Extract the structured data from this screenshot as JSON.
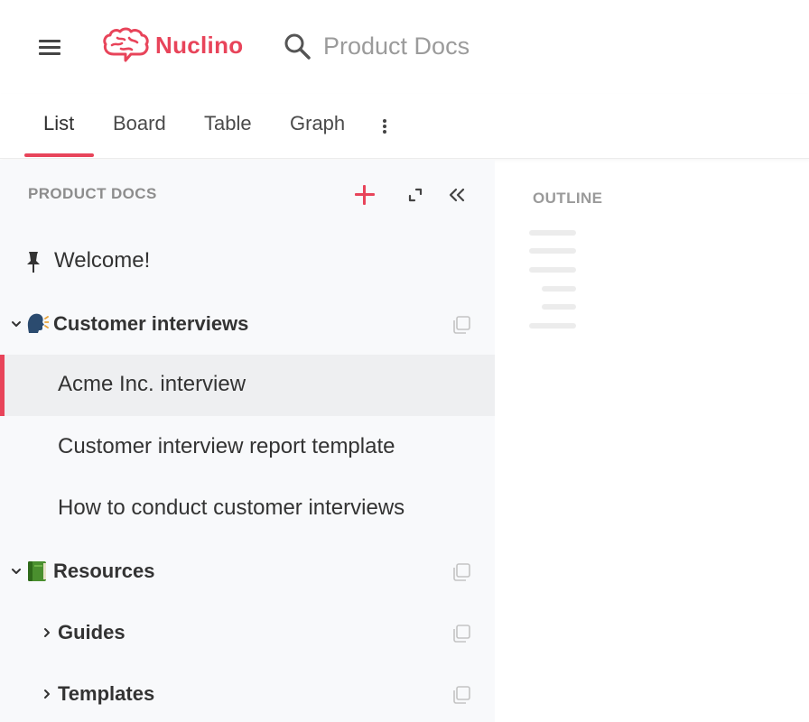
{
  "header": {
    "logo_text": "Nuclino",
    "search_text": "Product Docs"
  },
  "tabs": [
    {
      "label": "List",
      "active": true
    },
    {
      "label": "Board",
      "active": false
    },
    {
      "label": "Table",
      "active": false
    },
    {
      "label": "Graph",
      "active": false
    }
  ],
  "sidebar": {
    "title": "PRODUCT DOCS",
    "items": [
      {
        "label": "Welcome!",
        "icon": "pin-icon",
        "bold": false
      },
      {
        "label": "Customer interviews",
        "icon": "speaking-head-emoji",
        "bold": true,
        "expanded": true
      },
      {
        "label": "Acme Inc. interview",
        "bold": false,
        "selected": true
      },
      {
        "label": "Customer interview report template",
        "bold": false
      },
      {
        "label": "How to conduct customer interviews",
        "bold": false
      },
      {
        "label": "Resources",
        "icon": "green-book-emoji",
        "bold": true,
        "expanded": true
      },
      {
        "label": "Guides",
        "bold": true,
        "expanded": false
      },
      {
        "label": "Templates",
        "bold": true,
        "expanded": false
      }
    ]
  },
  "outline": {
    "title": "OUTLINE"
  },
  "colors": {
    "accent": "#e8445a",
    "sidebar_bg": "#f8f9fb",
    "selected_bg": "#eeeff1"
  }
}
